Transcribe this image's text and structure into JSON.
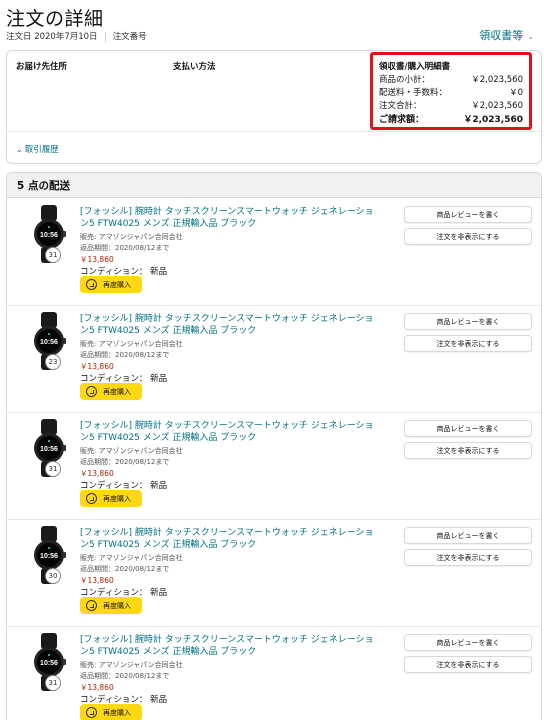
{
  "page": {
    "title": "注文の詳細",
    "order_date_label": "注文日 2020年7月10日",
    "order_number_label": "注文番号",
    "receipt_link": "領収書等"
  },
  "summary": {
    "shipping_address_label": "お届け先住所",
    "payment_method_label": "支払い方法",
    "history_toggle": "取引履歴"
  },
  "totals": {
    "title": "領収書/購入明細書",
    "rows": [
      {
        "label": "商品の小計：",
        "value": "￥2,023,560"
      },
      {
        "label": "配送料・手数料：",
        "value": "￥0"
      },
      {
        "label": "注文合計：",
        "value": "￥2,023,560"
      },
      {
        "label": "ご請求額：",
        "value": "￥2,023,560"
      }
    ],
    "highlight_color": "#e3101c"
  },
  "shipment": {
    "header": "5 点の配送",
    "items": [
      {
        "title": "[フォッシル] 腕時計 タッチスクリーンスマートウォッチ ジェネレーション5 FTW4025 メンズ 正規輸入品 ブラック",
        "seller": "販売: アマゾンジャパン合同会社",
        "return_window": "返品期間：2020/08/12まで",
        "price": "￥13,860",
        "condition": "コンディション： 新品",
        "rebuy": "再度購入",
        "quantity_badge": "31",
        "review_button": "商品レビューを書く",
        "hide_button": "注文を非表示にする"
      },
      {
        "title": "[フォッシル] 腕時計 タッチスクリーンスマートウォッチ ジェネレーション5 FTW4025 メンズ 正規輸入品 ブラック",
        "seller": "販売: アマゾンジャパン合同会社",
        "return_window": "返品期間：2020/08/12まで",
        "price": "￥13,860",
        "condition": "コンディション： 新品",
        "rebuy": "再度購入",
        "quantity_badge": "23",
        "review_button": "商品レビューを書く",
        "hide_button": "注文を非表示にする"
      },
      {
        "title": "[フォッシル] 腕時計 タッチスクリーンスマートウォッチ ジェネレーション5 FTW4025 メンズ 正規輸入品 ブラック",
        "seller": "販売: アマゾンジャパン合同会社",
        "return_window": "返品期間：2020/08/12まで",
        "price": "￥13,860",
        "condition": "コンディション： 新品",
        "rebuy": "再度購入",
        "quantity_badge": "31",
        "review_button": "商品レビューを書く",
        "hide_button": "注文を非表示にする"
      },
      {
        "title": "[フォッシル] 腕時計 タッチスクリーンスマートウォッチ ジェネレーション5 FTW4025 メンズ 正規輸入品 ブラック",
        "seller": "販売: アマゾンジャパン合同会社",
        "return_window": "返品期間：2020/08/12まで",
        "price": "￥13,860",
        "condition": "コンディション： 新品",
        "rebuy": "再度購入",
        "quantity_badge": "30",
        "review_button": "商品レビューを書く",
        "hide_button": "注文を非表示にする"
      },
      {
        "title": "[フォッシル] 腕時計 タッチスクリーンスマートウォッチ ジェネレーション5 FTW4025 メンズ 正規輸入品 ブラック",
        "seller": "販売: アマゾンジャパン合同会社",
        "return_window": "返品期間：2020/08/12まで",
        "price": "￥13,860",
        "condition": "コンディション： 新品",
        "rebuy": "再度購入",
        "quantity_badge": "31",
        "review_button": "商品レビューを書く",
        "hide_button": "注文を非表示にする"
      }
    ]
  },
  "colors": {
    "link": "#007185",
    "price": "#b12704",
    "rebuy_button": "#ffd814"
  }
}
